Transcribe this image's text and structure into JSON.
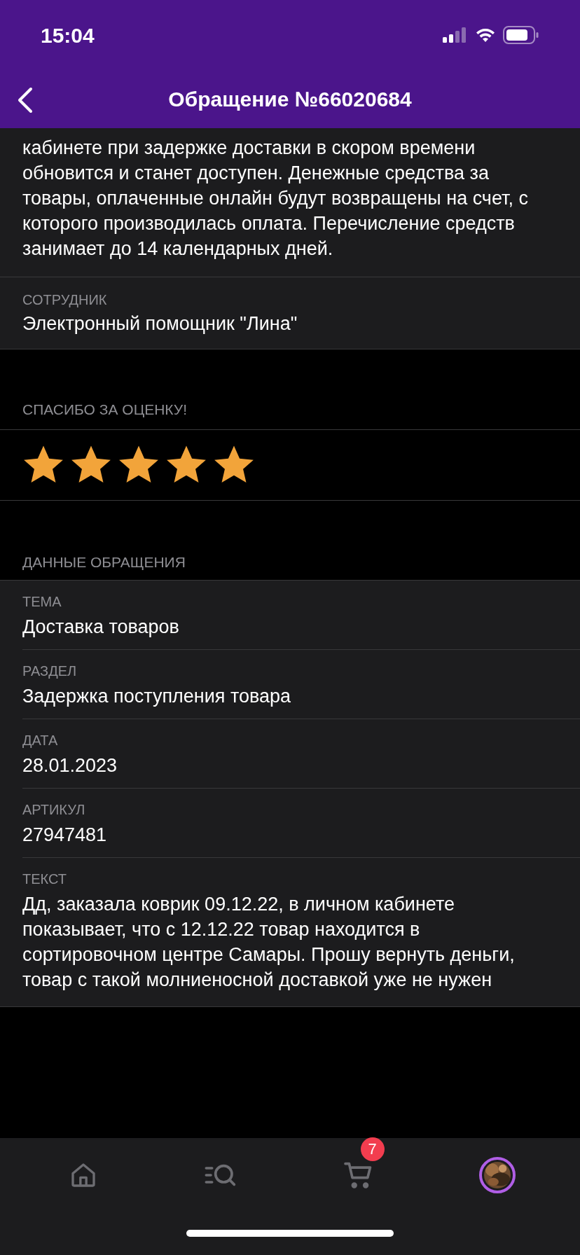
{
  "status_bar": {
    "time": "15:04"
  },
  "header": {
    "title": "Обращение №66020684"
  },
  "answer": {
    "text": "кабинете при задержке доставки в скором времени обновится и станет доступен. Денежные средства за товары, оплаченные онлайн будут возвращены на счет, с которого производилась оплата. Перечисление средств занимает до 14 календарных дней.",
    "employee_label": "СОТРУДНИК",
    "employee": "Электронный помощник \"Лина\""
  },
  "rating": {
    "title": "СПАСИБО ЗА ОЦЕНКУ!",
    "stars": 5
  },
  "details": {
    "title": "ДАННЫЕ ОБРАЩЕНИЯ",
    "fields": [
      {
        "label": "ТЕМА",
        "value": "Доставка товаров"
      },
      {
        "label": "РАЗДЕЛ",
        "value": "Задержка поступления товара"
      },
      {
        "label": "ДАТА",
        "value": "28.01.2023"
      },
      {
        "label": "АРТИКУЛ",
        "value": "27947481"
      },
      {
        "label": "ТЕКСТ",
        "value": "Дд, заказала коврик 09.12.22, в личном кабинете показывает, что с 12.12.22 товар находится в сортировочном центре Самары. Прошу вернуть деньги, товар с такой молниеносной доставкой уже не нужен"
      }
    ]
  },
  "tab_bar": {
    "items": [
      {
        "kind": "home"
      },
      {
        "kind": "search"
      },
      {
        "kind": "cart",
        "badge": "7"
      },
      {
        "kind": "profile"
      }
    ]
  }
}
